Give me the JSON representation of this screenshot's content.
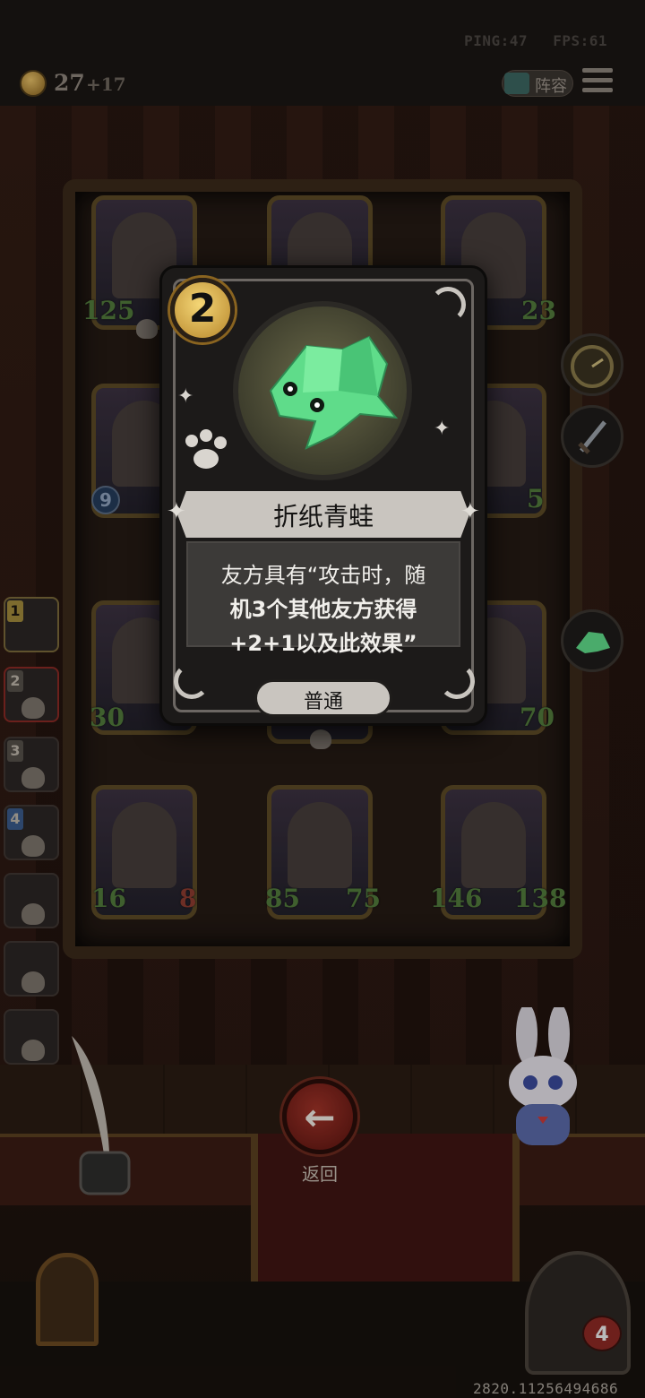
{
  "status": {
    "ping": "PING:47",
    "fps": "FPS:61"
  },
  "header": {
    "coins": "27",
    "coin_income": "+17",
    "lineup_label": "阵容"
  },
  "board": {
    "heroes": [
      {
        "attack": "125",
        "health": ""
      },
      {
        "attack": "",
        "health": ""
      },
      {
        "attack": "",
        "health": "23"
      },
      {
        "attack": "9",
        "health": ""
      },
      {
        "attack": "",
        "health": ""
      },
      {
        "attack": "",
        "health": "5"
      },
      {
        "attack": "30",
        "health": ""
      },
      {
        "attack": "",
        "health": ""
      },
      {
        "attack": "",
        "health": "70"
      },
      {
        "attack": "16",
        "health": "8"
      },
      {
        "attack": "85",
        "health": "75"
      },
      {
        "attack": "146",
        "health": "138"
      }
    ]
  },
  "roster": [
    {
      "num": "1"
    },
    {
      "num": "2"
    },
    {
      "num": "3"
    },
    {
      "num": "4"
    },
    {
      "num": ""
    },
    {
      "num": ""
    },
    {
      "num": ""
    },
    {
      "num": ""
    }
  ],
  "card": {
    "cost": "2",
    "name": "折纸青蛙",
    "description_lines": [
      "友方具有“攻击时，随",
      "机3个其他友方获得",
      "+2+1以及此效果”"
    ],
    "rarity": "普通",
    "art_icon": "origami-frog-icon"
  },
  "actions": {
    "back_label": "返回"
  },
  "footer": {
    "lives": "4",
    "version": "2820.11256494686"
  },
  "colors": {
    "gold": "#e7c067",
    "attack_green": "#517a3c",
    "frog_green": "#5fdc8a",
    "back_red": "#a03328"
  }
}
